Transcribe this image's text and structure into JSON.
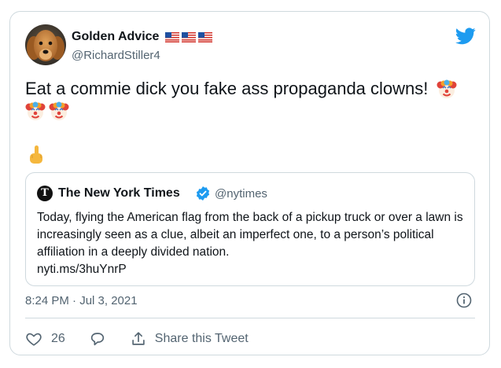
{
  "author": {
    "display_name": "Golden Advice",
    "flag_emojis": [
      "🇺🇸",
      "🇺🇸",
      "🇺🇸"
    ],
    "handle": "@RichardStiller4",
    "avatar": "golden-retriever-avatar"
  },
  "brand": {
    "icon": "twitter-bird-icon",
    "color": "#1d9bf0"
  },
  "tweet": {
    "text": "Eat a commie dick you fake ass propaganda clowns!",
    "emojis": [
      "🤡",
      "🤡",
      "🤡",
      "🖕"
    ]
  },
  "quoted_tweet": {
    "logo": "nyt-logo",
    "name": "The New York Times",
    "verified": true,
    "handle": "@nytimes",
    "text": "Today, flying the American flag from the back of a pickup truck or over a lawn is increasingly seen as a clue, albeit an imperfect one, to a person’s political affiliation in a deeply divided nation.",
    "link": "nyti.ms/3huYnrP"
  },
  "timestamp": "8:24 PM · Jul 3, 2021",
  "actions": {
    "like_count": "26",
    "like_icon": "heart-icon",
    "reply_icon": "reply-bubble-icon",
    "share_label": "Share this Tweet",
    "share_icon": "share-icon",
    "info_icon": "info-icon"
  },
  "colors": {
    "text_primary": "#0f1419",
    "text_secondary": "#536471",
    "border": "#cfd9de",
    "verified_blue": "#1d9bf0"
  }
}
